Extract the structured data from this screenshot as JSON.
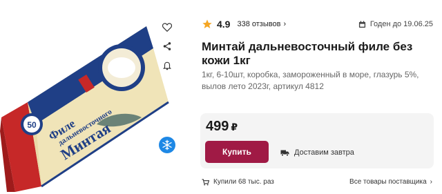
{
  "product": {
    "image_alt": "Пачка филе минтая",
    "package_texts": {
      "line1": "Филе",
      "line2": "дальневосточного",
      "line3": "Минтая",
      "badge": "50"
    }
  },
  "rating": {
    "value": "4.9",
    "reviews_label": "338 отзывов",
    "chevron": "›"
  },
  "expiry": {
    "label": "Годен до 19.06.25",
    "icon": "calendar-icon"
  },
  "title": "Минтай дальневосточный филе без кожи 1кг",
  "description": "1кг, 6-10шт, коробка, замороженный в море, глазурь 5%, вылов лето 2023г, артикул 4812",
  "buy_card": {
    "price": "499",
    "currency": "₽",
    "buy_label": "Купить",
    "delivery_label": "Доставим завтра"
  },
  "footer": {
    "bought_label": "Купили 68 тыс. раз",
    "all_goods_label": "Все товары поставщика",
    "chevron": "›"
  },
  "colors": {
    "accent": "#a01a45",
    "star": "#f5a623",
    "frozen_badge": "#1e88e5",
    "card_bg": "#f4f4f4"
  }
}
